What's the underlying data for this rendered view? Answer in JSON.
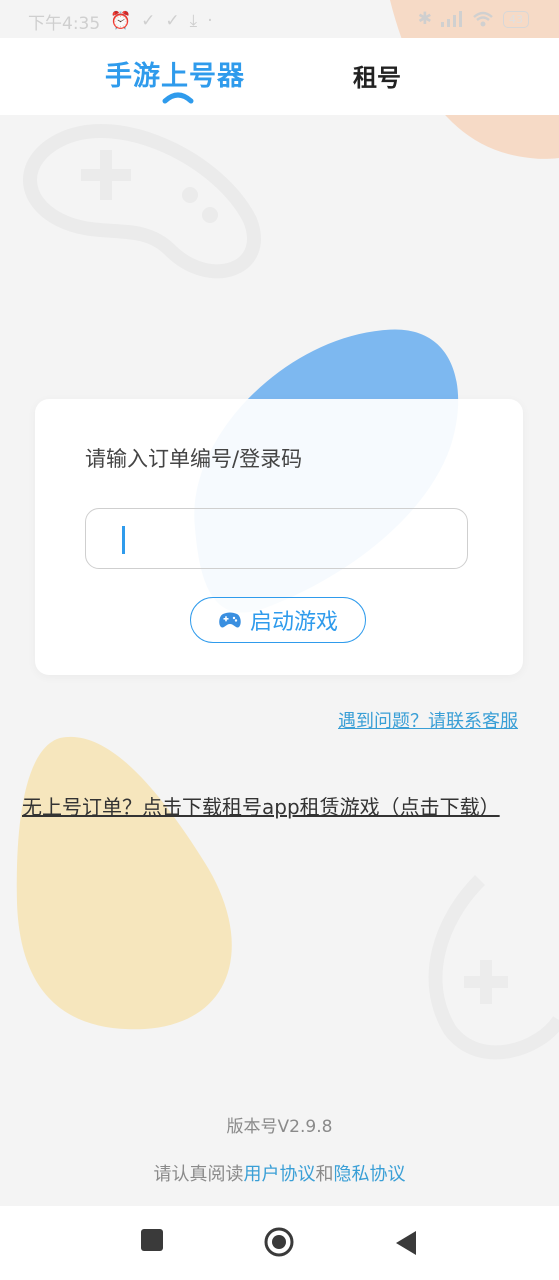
{
  "status_bar": {
    "time": "下午4:35",
    "battery": "43"
  },
  "header": {
    "tabs": [
      {
        "label": "手游上号器",
        "active": true
      },
      {
        "label": "租号",
        "active": false
      }
    ]
  },
  "login_card": {
    "label": "请输入订单编号/登录码",
    "input_value": "",
    "start_button_label": "启动游戏"
  },
  "help_link": "遇到问题？请联系客服",
  "download_link": "无上号订单？点击下载租号app租赁游戏（点击下载）",
  "footer": {
    "version": "版本号V2.9.8",
    "agreement_prefix": "请认真阅读",
    "user_agreement": "用户协议",
    "joiner": "和",
    "privacy_agreement": "隐私协议"
  },
  "colors": {
    "accent": "#2f9bec",
    "link": "#3a9fd6",
    "blob_blue": "#7db8f0",
    "blob_yellow": "#f6e6bd",
    "blob_peach": "#f6dac6"
  }
}
